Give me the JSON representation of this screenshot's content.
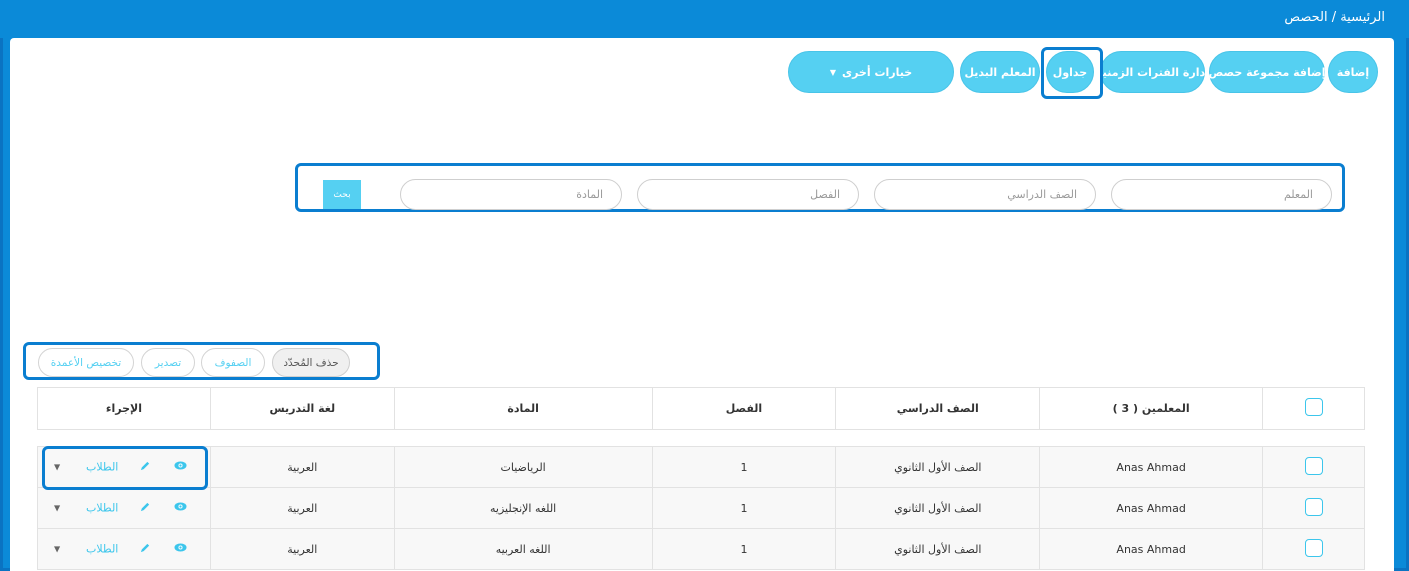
{
  "breadcrumb": "الرئيسية / الحصص",
  "toolbar": {
    "add": "إضافة",
    "add_group": "إضافة مجموعة حصص",
    "manage_periods": "إدارة الفترات الزمنية",
    "schedules": "جداول",
    "substitute_teacher": "المعلم البديل",
    "more_options": "خيارات أخرى"
  },
  "filters": {
    "teacher_placeholder": "المعلم",
    "grade_placeholder": "الصف الدراسي",
    "class_placeholder": "الفصل",
    "subject_placeholder": "المادة",
    "search_label": "بحث"
  },
  "table_tools": {
    "delete_selected": "حذف المُحدّد",
    "rows": "الصفوف",
    "export": "تصدير",
    "customize_columns": "تخصيص الأعمدة"
  },
  "table": {
    "headers": {
      "teachers": "المعلمين ( 3 )",
      "grade": "الصف الدراسي",
      "class": "الفصل",
      "subject": "المادة",
      "language": "لغة التدريس",
      "actions": "الإجراء"
    },
    "students_label": "الطلاب",
    "rows": [
      {
        "teacher": "Anas Ahmad",
        "grade": "الصف الأول الثانوي",
        "class": "1",
        "subject": "الرياضيات",
        "language": "العربية"
      },
      {
        "teacher": "Anas Ahmad",
        "grade": "الصف الأول الثانوي",
        "class": "1",
        "subject": "اللغه الإنجليزيه",
        "language": "العربية"
      },
      {
        "teacher": "Anas Ahmad",
        "grade": "الصف الأول الثانوي",
        "class": "1",
        "subject": "اللغه العربيه",
        "language": "العربية"
      }
    ]
  },
  "colors": {
    "accent": "#55d0f2",
    "header_bar": "#0b8ad8",
    "highlight_border": "#0a7ed0"
  }
}
